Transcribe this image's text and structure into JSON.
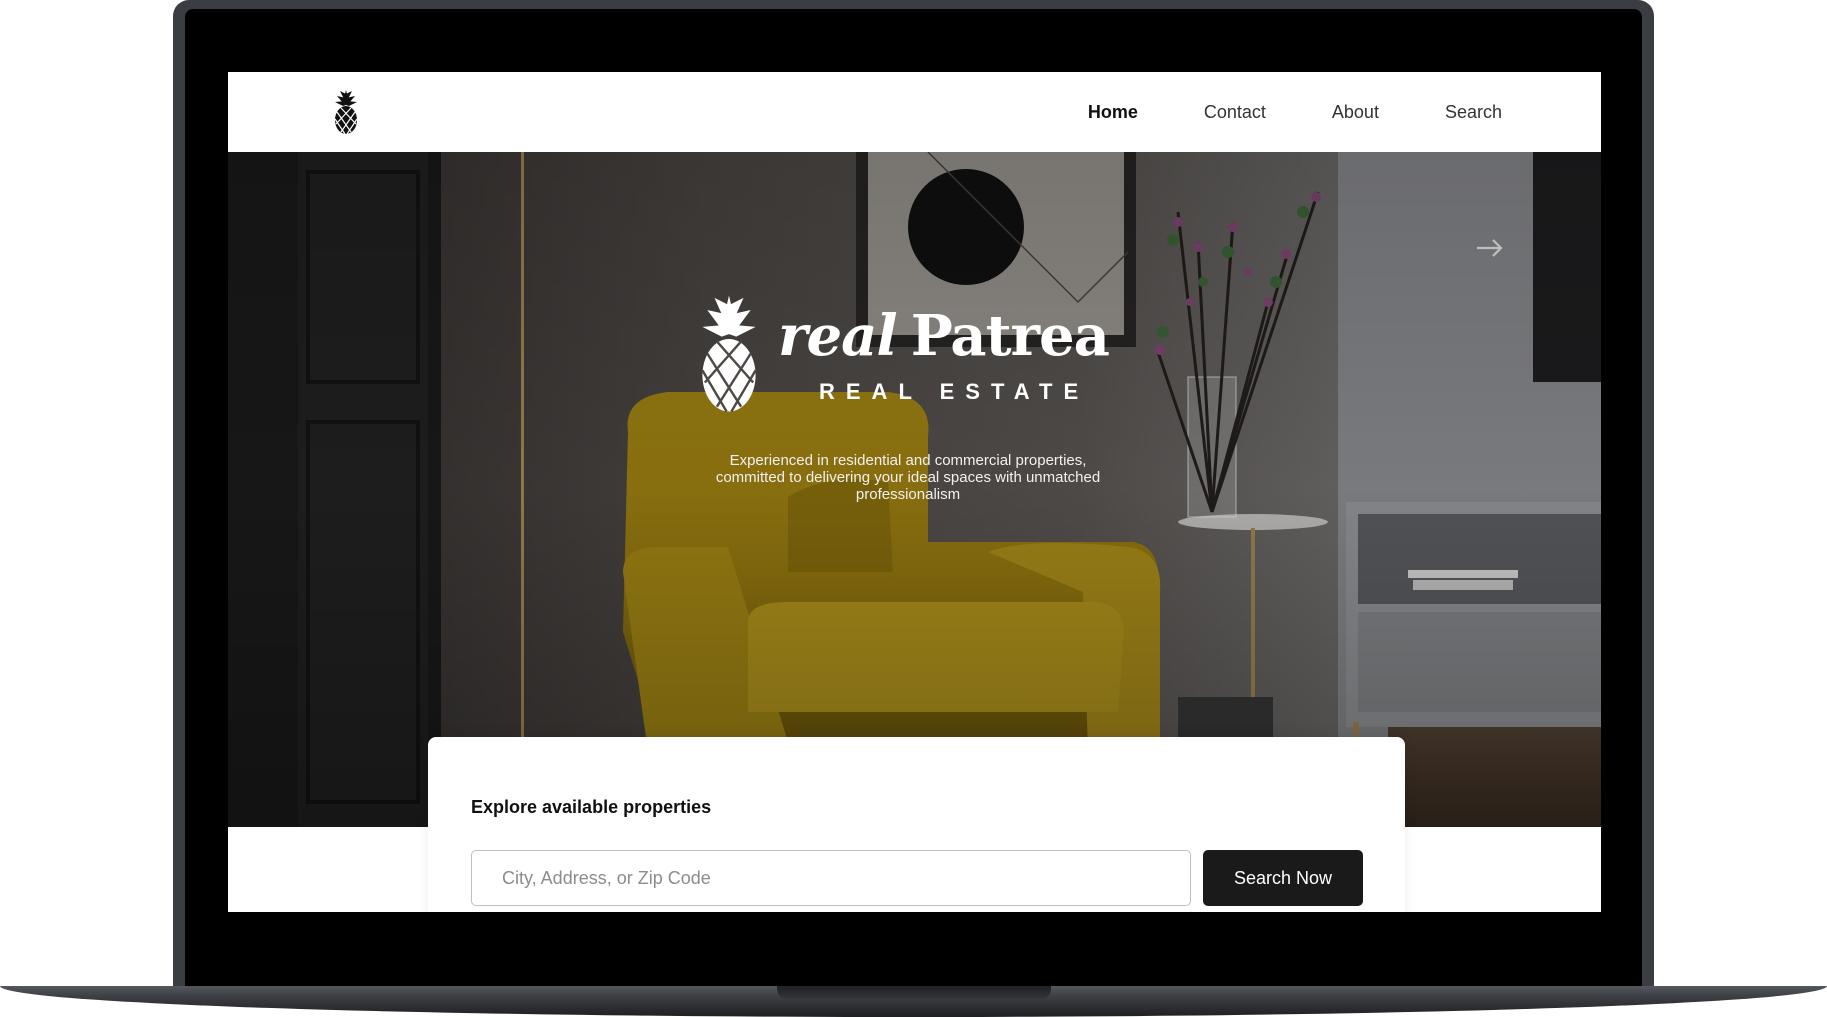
{
  "nav": {
    "links": [
      {
        "label": "Home",
        "active": true
      },
      {
        "label": "Contact",
        "active": false
      },
      {
        "label": "About",
        "active": false
      },
      {
        "label": "Search",
        "active": false
      }
    ]
  },
  "hero": {
    "brand_real": "real",
    "brand_patrea": "Patrea",
    "brand_sub": "REAL ESTATE",
    "tagline": "Experienced in residential and commercial properties, committed to delivering your ideal spaces with unmatched professionalism",
    "image_subject": "living room with yellow armchair, side table with vase of flowers, framed art and grey cabinet"
  },
  "search": {
    "title": "Explore available properties",
    "placeholder": "City, Address, or Zip Code",
    "value": "",
    "button_label": "Search Now"
  },
  "icons": {
    "logo": "pineapple-icon",
    "carousel_next": "arrow-right-icon"
  },
  "colors": {
    "accent_button": "#1a1a1a",
    "armchair": "#b8951a",
    "laptop_frame": "#3a3d42"
  }
}
